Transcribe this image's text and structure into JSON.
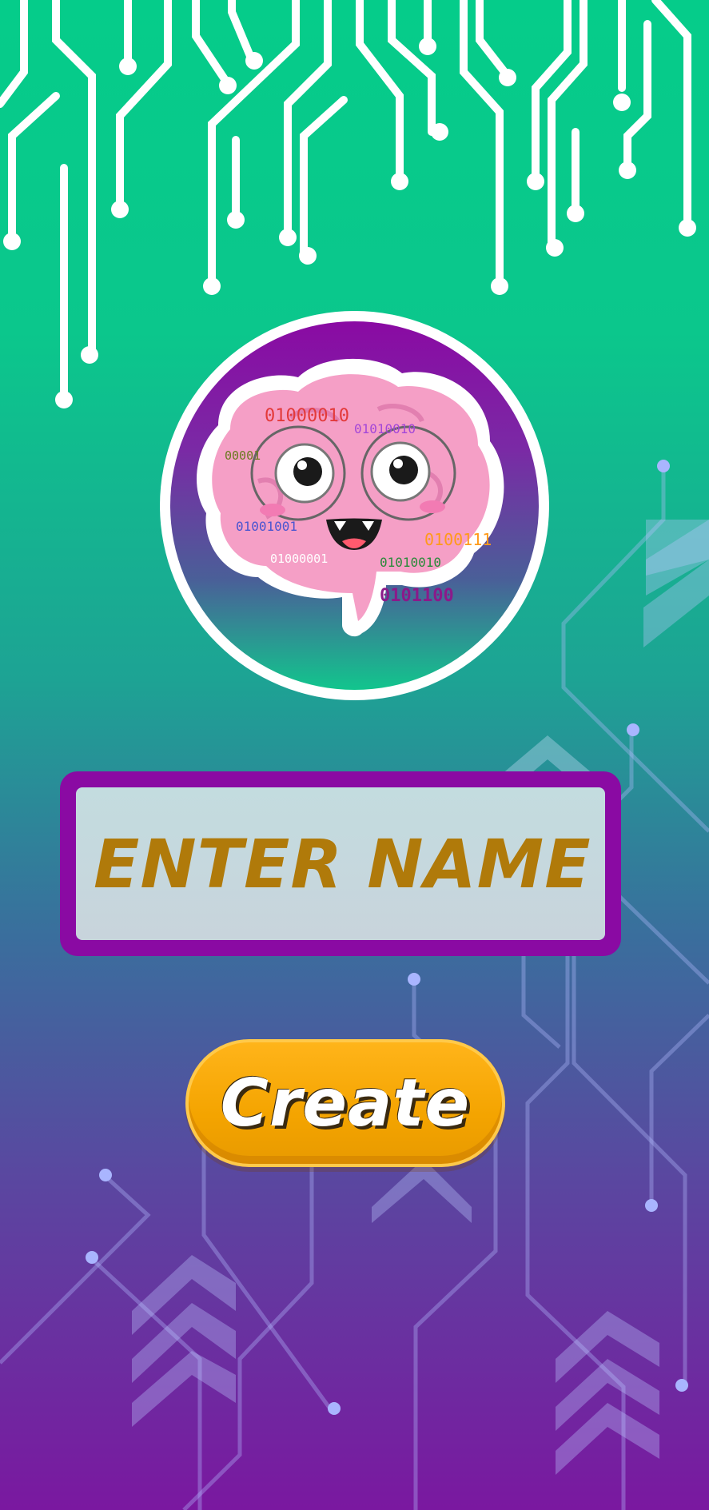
{
  "form": {
    "name_placeholder": "Enter Name",
    "name_value": ""
  },
  "actions": {
    "create_label": "Create"
  },
  "logo": {
    "binary_strings": [
      "01000010",
      "01010010",
      "00001",
      "01001001",
      "0100111",
      "01000001",
      "01010010",
      "0101100"
    ]
  },
  "colors": {
    "top": "#05cc8a",
    "bottom": "#7a18a0",
    "frame": "#8a0aa3",
    "button": "#f4a400",
    "placeholder": "#b07a0a"
  }
}
